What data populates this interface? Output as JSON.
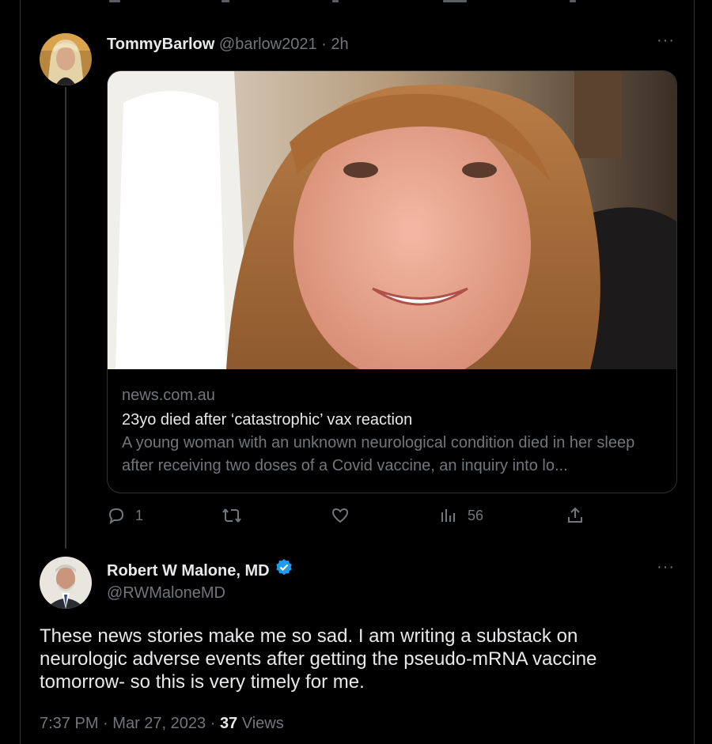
{
  "tweet_quoted": {
    "display_name": "TommyBarlow",
    "handle": "@barlow2021",
    "separator": "·",
    "time": "2h",
    "more_label": "···",
    "card": {
      "domain": "news.com.au",
      "title": "23yo died after ‘catastrophic’ vax reaction",
      "description": "A young woman with an unknown neurological condition died in her sleep after receiving two doses of a Covid vaccine, an inquiry into lo..."
    },
    "actions": {
      "reply_icon": "reply-icon",
      "reply_count": "1",
      "retweet_icon": "retweet-icon",
      "like_icon": "heart-icon",
      "views_icon": "views-chart-icon",
      "views_count": "56",
      "share_icon": "share-icon"
    }
  },
  "tweet_main": {
    "display_name": "Robert W Malone, MD",
    "handle": "@RWMaloneMD",
    "verified_icon": "verified-badge-icon",
    "more_label": "···",
    "body": "These news stories make me so sad.  I am writing a substack on\nneurologic adverse events after getting the pseudo-mRNA vaccine\ntomorrow- so this is very timely for me.",
    "time": "7:37 PM",
    "date": "Mar 27, 2023",
    "separator": "·",
    "views_count": "37",
    "views_label": "Views"
  },
  "colors": {
    "background": "#000000",
    "text": "#e7e9ea",
    "muted": "#71767b",
    "border": "#2f3336",
    "verified": "#1d9bf0"
  }
}
